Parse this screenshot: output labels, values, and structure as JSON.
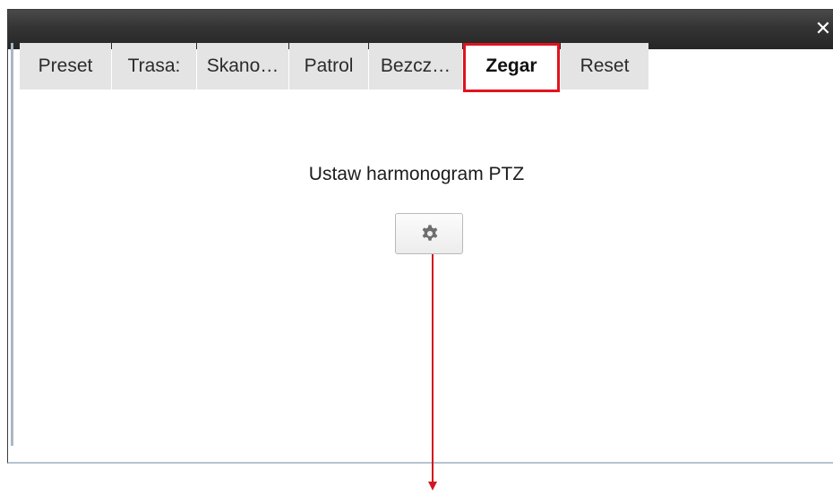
{
  "dialog": {
    "close_label": "✕"
  },
  "tabs": [
    {
      "label": "Preset",
      "active": false
    },
    {
      "label": "Trasa:",
      "active": false
    },
    {
      "label": "Skano…",
      "active": false
    },
    {
      "label": "Patrol",
      "active": false
    },
    {
      "label": "Bezcz…",
      "active": false
    },
    {
      "label": "Zegar",
      "active": true
    },
    {
      "label": "Reset",
      "active": false
    }
  ],
  "content": {
    "title": "Ustaw harmonogram PTZ",
    "settings_icon": "gear-icon"
  },
  "colors": {
    "titlebar": "#2e2e2e",
    "highlight": "#e0141e",
    "tab_bg": "#e4e4e4"
  }
}
